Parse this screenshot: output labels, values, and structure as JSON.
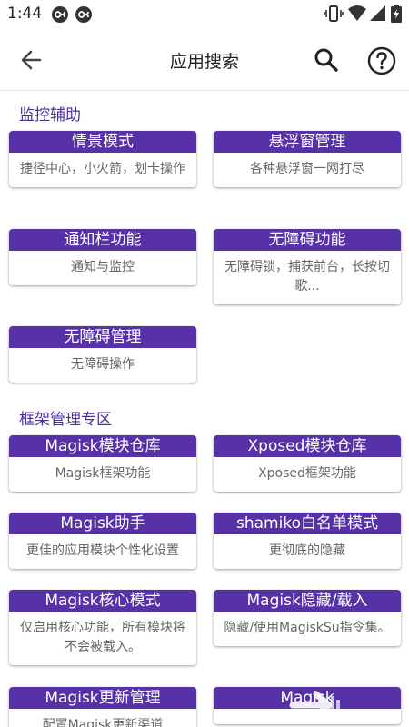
{
  "status_bar": {
    "time": "1:44"
  },
  "app_bar": {
    "title": "应用搜索"
  },
  "sections": [
    {
      "title": "监控辅助",
      "cards": [
        {
          "title": "情景模式",
          "desc": "捷径中心，小火箭，划卡操作"
        },
        {
          "title": "悬浮窗管理",
          "desc": "各种悬浮窗一网打尽"
        },
        {
          "title": "通知栏功能",
          "desc": "通知与监控"
        },
        {
          "title": "无障碍功能",
          "desc": "无障碍锁，捕获前台，长按切歌..."
        },
        {
          "title": "无障碍管理",
          "desc": "无障碍操作"
        }
      ]
    },
    {
      "title": "框架管理专区",
      "cards": [
        {
          "title": "Magisk模块仓库",
          "desc": "Magisk框架功能"
        },
        {
          "title": "Xposed模块仓库",
          "desc": "Xposed框架功能"
        },
        {
          "title": "Magisk助手",
          "desc": "更佳的应用模块个性化设置"
        },
        {
          "title": "shamiko白名单模式",
          "desc": "更彻底的隐藏"
        },
        {
          "title": "Magisk核心模式",
          "desc": "仅启用核心功能，所有模块将不会被载入。"
        },
        {
          "title": "Magisk隐藏/载入",
          "desc": "隐藏/使用MagiskSu指令集。"
        },
        {
          "title": "Magisk更新管理",
          "desc": "配置Magisk更新渠道"
        },
        {
          "title": "Magisk",
          "desc": ""
        }
      ]
    }
  ]
}
